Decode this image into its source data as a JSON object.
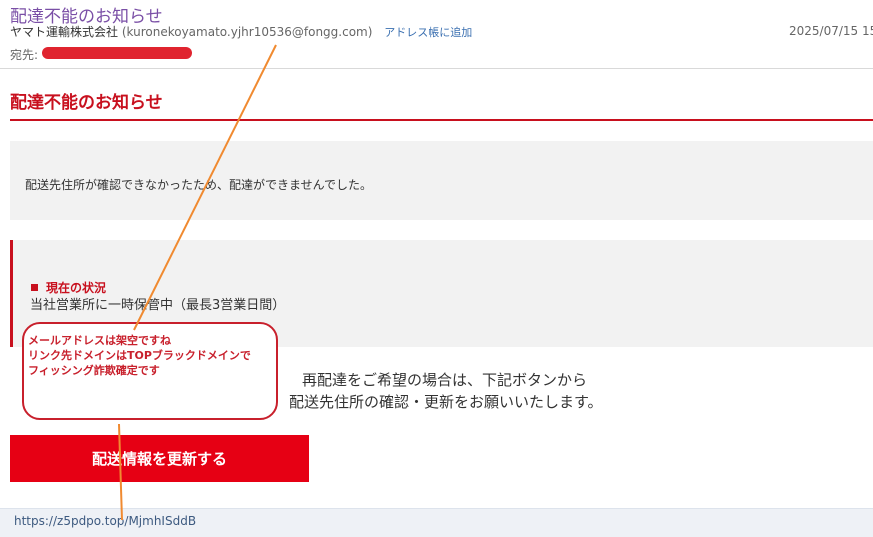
{
  "email": {
    "subject": "配達不能のお知らせ",
    "sender_name": "ヤマト運輸株式会社",
    "sender_address": "(kuronekoyamato.yjhr10536@fongg.com)",
    "add_to_address_book": "アドレス帳に追加",
    "date": "2025/07/15 15",
    "to_label": "宛先:"
  },
  "body": {
    "title": "配達不能のお知らせ",
    "notice": "配送先住所が確認できなかったため、配達ができませんでした。",
    "status_heading": "現在の状況",
    "status_text": "当社営業所に一時保管中（最長3営業日間）",
    "redeliver_line1": "再配達をご希望の場合は、下記ボタンから",
    "redeliver_line2": "配送先住所の確認・更新をお願いいたします。",
    "button_label": "配送情報を更新する"
  },
  "statusbar": {
    "url": "https://z5pdpo.top/MjmhISddB"
  },
  "annotation": {
    "line1": "メールアドレスは架空ですね",
    "line2": "リンク先ドメインはTOPブラックドメインで",
    "line3": "フィッシング詐欺確定です"
  },
  "colors": {
    "brand_red": "#e60014",
    "heading_red": "#c8101e",
    "subject_purple": "#7a4fa6",
    "annotation_arrow": "#f08a30"
  }
}
